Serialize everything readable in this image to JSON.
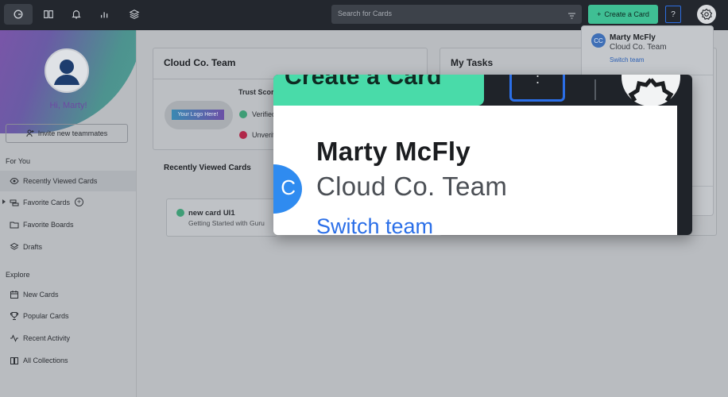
{
  "topbar": {
    "search_placeholder": "Search for Cards",
    "create_label": "Create a Card",
    "help_label": "?"
  },
  "sidebar": {
    "greeting": "Hi, Marty!",
    "invite_label": "Invite new teammates",
    "for_you_title": "For You",
    "for_you_items": [
      "Recently Viewed Cards",
      "Favorite Cards",
      "Favorite Boards",
      "Drafts"
    ],
    "explore_title": "Explore",
    "explore_items": [
      "New Cards",
      "Popular Cards",
      "Recent Activity",
      "All Collections"
    ]
  },
  "main": {
    "team_card_title": "Cloud Co. Team",
    "logo_placeholder": "Your Logo Here!",
    "trust_score_label": "Trust Score",
    "verified_label": "Verified",
    "unverified_label": "Unverified",
    "tasks_title": "My Tasks",
    "recently_viewed_title": "Recently Viewed Cards",
    "recent_card": {
      "title": "new card UI1",
      "subtitle": "Getting Started with Guru"
    }
  },
  "dropdown": {
    "initials": "CC",
    "name": "Marty McFly",
    "team": "Cloud Co. Team",
    "switch_label": "Switch team"
  },
  "zoom": {
    "create_label": "Create a Card",
    "help_glyph": ":",
    "initial": "C",
    "name": "Marty McFly",
    "team": "Cloud Co. Team",
    "switch_label": "Switch team"
  },
  "colors": {
    "accent_green": "#49dba9",
    "link_blue": "#2b6fe8",
    "topbar": "#23272e",
    "overlay_gray": "#b9bcc0"
  }
}
